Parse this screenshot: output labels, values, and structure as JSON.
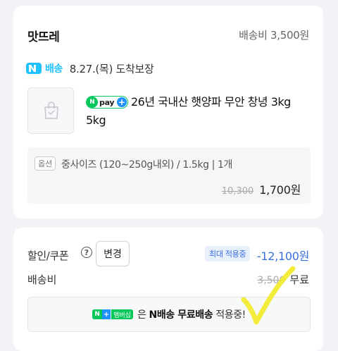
{
  "store": {
    "name": "맛뜨레",
    "shipping_fee": "배송비 3,500원"
  },
  "delivery": {
    "badge_label": "배송",
    "date_text": "8.27.(목) 도착보장"
  },
  "product": {
    "pay_badge": "pay",
    "name": "26년 국내산 햇양파 무안 창녕 3kg 5kg",
    "option_tag": "옵션",
    "option_text": "중사이즈 (120~250g내외) / 1.5kg",
    "quantity": "1개",
    "original_price": "10,300",
    "price": "1,700원"
  },
  "discount": {
    "label": "할인/쿠폰",
    "help_icon": "?",
    "change_button": "변경",
    "max_badge": "최대 적용중",
    "amount": "-12,100원"
  },
  "shipping": {
    "label": "배송비",
    "original": "3,500",
    "value": "무료"
  },
  "membership": {
    "badge_n": "N",
    "badge_plus": "+",
    "badge_label": "멤버십",
    "text_prefix": "은",
    "text_bold": "N배송 무료배송",
    "text_suffix": "적용중!"
  },
  "colors": {
    "n_delivery": "#1ec3ff",
    "npay_green": "#03c75a",
    "accent_blue": "#3a6fe0",
    "checkmark_yellow": "#f2ea2a"
  }
}
